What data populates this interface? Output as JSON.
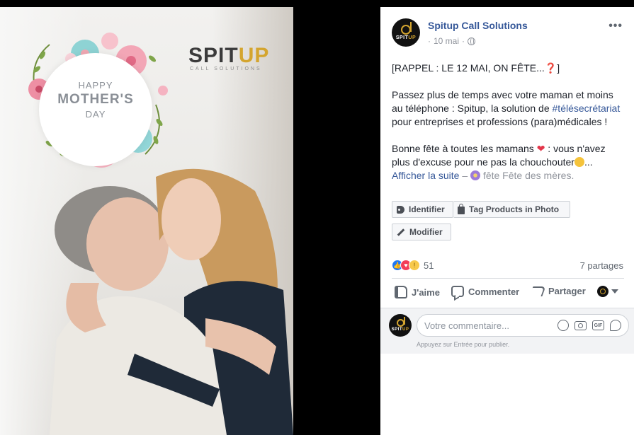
{
  "photo": {
    "greeting": {
      "line1": "HAPPY",
      "line2": "MOTHER'S",
      "line3": "DAY"
    },
    "brand": {
      "part1": "SPIT",
      "part2": "UP",
      "tagline": "CALL SOLUTIONS"
    }
  },
  "post": {
    "page_name": "Spitup Call Solutions",
    "avatar_text_a": "SPIT",
    "avatar_text_b": "UP",
    "date": "10 mai",
    "date_separator": "·",
    "more_label": "•••",
    "text": {
      "p1": "[RAPPEL : LE 12 MAI, ON FÊTE...",
      "p1_emoji": "❓",
      "p1_end": "]",
      "p2_a": "Passez plus de temps avec votre maman et moins au téléphone : Spitup, la solution de ",
      "p2_hashtag": "#télésecrétariat",
      "p2_b": " pour entreprises et professions (para)médicales !",
      "p3_a": "Bonne fête à toutes les mamans ",
      "p3_heart": "❤",
      "p3_b": " : vous n'avez plus d'excuse pour ne pas la chouchouter",
      "p3_ellipsis": "...",
      "see_more": "Afficher la suite",
      "dash": " – ",
      "feeling": "fête Fête des mères."
    },
    "buttons": {
      "identify": "Identifier",
      "tag_products": "Tag Products in Photo",
      "modify": "Modifier"
    },
    "reactions": {
      "like_glyph": "👍",
      "love_glyph": "♥",
      "wow_glyph": "!",
      "count": "51"
    },
    "shares": "7 partages",
    "actions": {
      "like": "J'aime",
      "comment": "Commenter",
      "share": "Partager"
    },
    "comment": {
      "placeholder": "Votre commentaire...",
      "gif_label": "GIF",
      "hint": "Appuyez sur Entrée pour publier."
    }
  },
  "colors": {
    "link": "#365899",
    "brand_gold": "#d4a52f",
    "like_blue": "#2078f4",
    "love_red": "#f33e58",
    "wow_yellow": "#f7c94b"
  }
}
